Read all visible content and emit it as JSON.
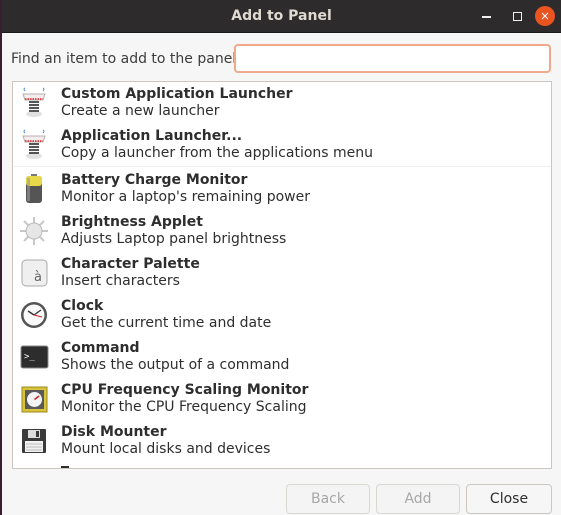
{
  "window": {
    "title": "Add to Panel",
    "controls": [
      "minimize",
      "maximize",
      "close"
    ]
  },
  "search": {
    "label": "Find an item to add to the panel:",
    "value": "",
    "placeholder": ""
  },
  "items": [
    {
      "name": "Custom Application Launcher",
      "description": "Create a new launcher",
      "icon": "launcher-spring-icon"
    },
    {
      "name": "Application Launcher...",
      "description": "Copy a launcher from the applications menu",
      "icon": "launcher-spring-icon"
    },
    {
      "name": "Battery Charge Monitor",
      "description": "Monitor a laptop's remaining power",
      "icon": "battery-icon"
    },
    {
      "name": "Brightness Applet",
      "description": "Adjusts Laptop panel brightness",
      "icon": "brightness-sun-icon"
    },
    {
      "name": "Character Palette",
      "description": "Insert characters",
      "icon": "character-palette-icon"
    },
    {
      "name": "Clock",
      "description": "Get the current time and date",
      "icon": "clock-icon"
    },
    {
      "name": "Command",
      "description": "Shows the output of a command",
      "icon": "terminal-icon"
    },
    {
      "name": "CPU Frequency Scaling Monitor",
      "description": "Monitor the CPU Frequency Scaling",
      "icon": "cpu-gauge-icon"
    },
    {
      "name": "Disk Mounter",
      "description": "Mount local disks and devices",
      "icon": "floppy-disk-icon"
    }
  ],
  "buttons": {
    "back": "Back",
    "add": "Add",
    "close": "Close"
  },
  "colors": {
    "accent": "#e95420",
    "titlebar": "#2d2b2b",
    "focus_border": "#f0a98a"
  }
}
